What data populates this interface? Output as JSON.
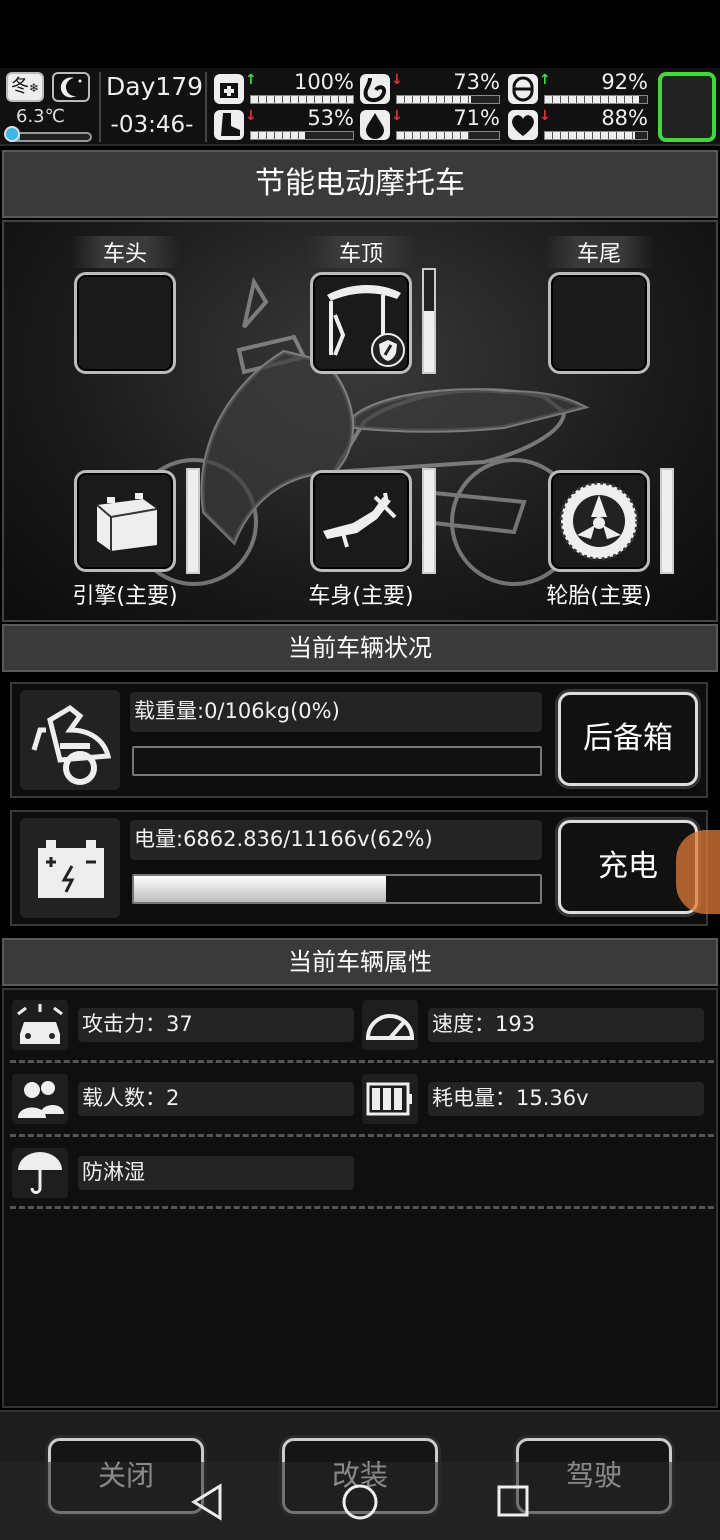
{
  "status": {
    "season": "冬",
    "temperature": "6.3℃",
    "temperature_level": 0.15,
    "day": "Day179",
    "time": "-03:46-",
    "stats": [
      {
        "name": "health",
        "icon": "medkit-icon",
        "trend": "up",
        "percent": "100%",
        "level": 1.0
      },
      {
        "name": "hunger",
        "icon": "stomach-icon",
        "trend": "down",
        "percent": "73%",
        "level": 0.73
      },
      {
        "name": "mood",
        "icon": "pill-icon",
        "trend": "up",
        "percent": "92%",
        "level": 0.92
      },
      {
        "name": "stamina",
        "icon": "boot-icon",
        "trend": "down",
        "percent": "53%",
        "level": 0.53
      },
      {
        "name": "thirst",
        "icon": "water-drop-icon",
        "trend": "down",
        "percent": "71%",
        "level": 0.71
      },
      {
        "name": "heart",
        "icon": "heart-icon",
        "trend": "down",
        "percent": "88%",
        "level": 0.88
      }
    ],
    "accent_green": "#46d43f"
  },
  "vehicle": {
    "name": "节能电动摩托车",
    "slots_top": [
      {
        "label": "车头"
      },
      {
        "label": "车顶",
        "level": 0.6
      },
      {
        "label": "车尾"
      }
    ],
    "parts": [
      {
        "label": "引擎(主要)",
        "icon": "battery-pack-icon",
        "level": 1.0
      },
      {
        "label": "车身(主要)",
        "icon": "motorcycle-frame-icon",
        "level": 1.0
      },
      {
        "label": "轮胎(主要)",
        "icon": "wheel-icon",
        "level": 1.0
      }
    ]
  },
  "condition": {
    "title": "当前车辆状况",
    "load_text": "载重量:0/106kg(0%)",
    "load_level": 0.0,
    "trunk_button": "后备箱",
    "battery_text": "电量:6862.836/11166v(62%)",
    "battery_level": 0.62,
    "charge_button": "充电"
  },
  "attributes": {
    "title": "当前车辆属性",
    "items": [
      {
        "icon": "car-attack-icon",
        "text": "攻击力：37"
      },
      {
        "icon": "speedometer-icon",
        "text": "速度：193"
      },
      {
        "icon": "passengers-icon",
        "text": "载人数：2"
      },
      {
        "icon": "battery-icon",
        "text": "耗电量：15.36v"
      },
      {
        "icon": "umbrella-icon",
        "text": "防淋湿"
      }
    ]
  },
  "actions": {
    "close": "关闭",
    "modify": "改装",
    "drive": "驾驶"
  }
}
